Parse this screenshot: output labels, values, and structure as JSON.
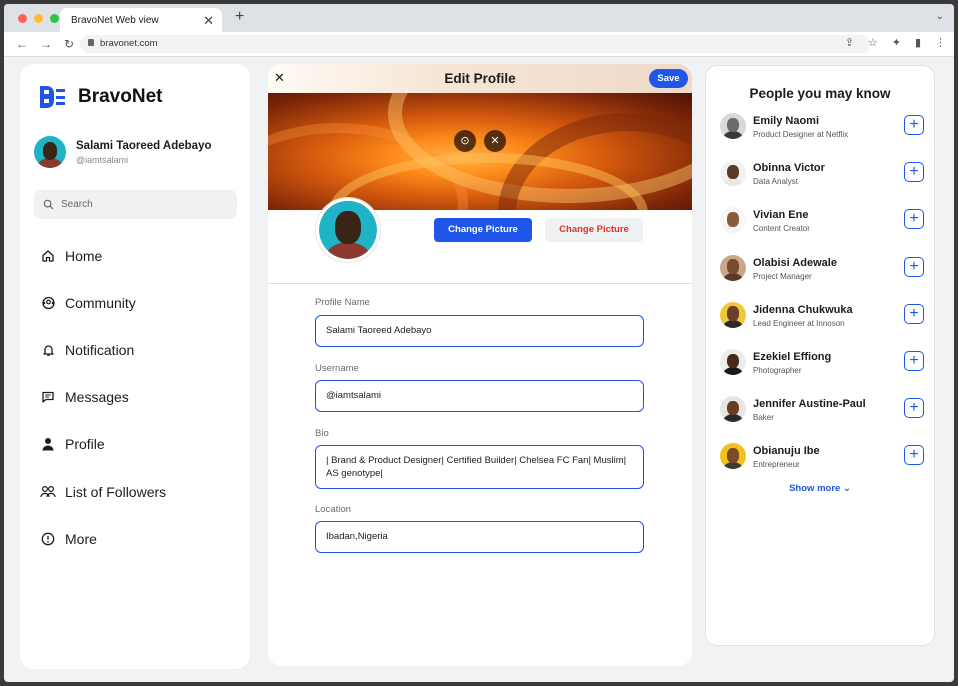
{
  "browser": {
    "tab_title": "BravoNet Web view",
    "url": "bravonet.com"
  },
  "sidebar": {
    "brand": "BravoNet",
    "user": {
      "name": "Salami Taoreed Adebayo",
      "handle": "@iamtsalami"
    },
    "search_placeholder": "Search",
    "nav": [
      {
        "label": "Home",
        "icon": "home-icon"
      },
      {
        "label": "Community",
        "icon": "community-icon"
      },
      {
        "label": "Notification",
        "icon": "bell-icon"
      },
      {
        "label": "Messages",
        "icon": "message-icon"
      },
      {
        "label": "Profile",
        "icon": "user-icon"
      },
      {
        "label": "List of Followers",
        "icon": "followers-icon"
      },
      {
        "label": "More",
        "icon": "more-icon"
      }
    ]
  },
  "edit_profile": {
    "title": "Edit Profile",
    "save_label": "Save",
    "change_picture_primary": "Change Picture",
    "change_picture_secondary": "Change Picture",
    "fields": {
      "profile_name": {
        "label": "Profile Name",
        "value": "Salami Taoreed Adebayo"
      },
      "username": {
        "label": "Username",
        "value": "@iamtsalami"
      },
      "bio": {
        "label": "Bio",
        "value": "| Brand & Product Designer| Certified Builder| Chelsea FC Fan| Muslim| AS genotype|"
      },
      "location": {
        "label": "Location",
        "value": "Ibadan,Nigeria"
      }
    }
  },
  "people": {
    "title": "People you may know",
    "show_more": "Show more",
    "list": [
      {
        "name": "Emily Naomi",
        "role": "Product Designer at Netflix",
        "skin": "#6b6b6b",
        "shirt": "#3a3a3a",
        "bg": "#d9d9d9"
      },
      {
        "name": "Obinna Victor",
        "role": "Data Analyst",
        "skin": "#5a3a28",
        "shirt": "#e8e8e8",
        "bg": "#f2f2f2"
      },
      {
        "name": "Vivian Ene",
        "role": "Content Creator",
        "skin": "#8a5a3a",
        "shirt": "#f4f4f4",
        "bg": "#f7f7f7"
      },
      {
        "name": "Olabisi Adewale",
        "role": "Project Manager",
        "skin": "#7a4a30",
        "shirt": "#5a3a2a",
        "bg": "#c9a88a"
      },
      {
        "name": "Jidenna Chukwuka",
        "role": "Lead Engineer at Innoson",
        "skin": "#6a4028",
        "shirt": "#2a2a2a",
        "bg": "#f0c93a"
      },
      {
        "name": "Ezekiel Effiong",
        "role": "Photographer",
        "skin": "#4a2a18",
        "shirt": "#1a1a1a",
        "bg": "#ececec"
      },
      {
        "name": "Jennifer Austine-Paul",
        "role": "Baker",
        "skin": "#6a3e24",
        "shirt": "#2a2a2a",
        "bg": "#e6e6e6"
      },
      {
        "name": "Obianuju Ibe",
        "role": "Entrepreneur",
        "skin": "#7a4a2a",
        "shirt": "#3a3a3a",
        "bg": "#f2c21a"
      }
    ]
  },
  "colors": {
    "accent": "#1f55e8",
    "danger": "#e0322b"
  }
}
